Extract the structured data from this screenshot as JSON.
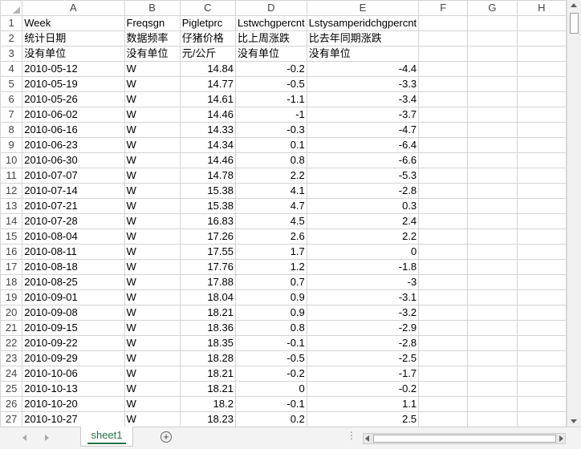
{
  "columns": [
    "",
    "A",
    "B",
    "C",
    "D",
    "E",
    "F",
    "G",
    "H"
  ],
  "rows": [
    {
      "n": "1",
      "cells": [
        "Week",
        "Freqsgn",
        "Pigletprc",
        "Lstwchgpercnt",
        "Lstysamperidchgpercnt",
        "",
        "",
        ""
      ]
    },
    {
      "n": "2",
      "cells": [
        "统计日期",
        "数据频率",
        "仔猪价格",
        "比上周涨跌",
        "比去年同期涨跌",
        "",
        "",
        ""
      ]
    },
    {
      "n": "3",
      "cells": [
        "没有单位",
        "没有单位",
        "元/公斤",
        "没有单位",
        "没有单位",
        "",
        "",
        ""
      ]
    },
    {
      "n": "4",
      "cells": [
        "2010-05-12",
        "W",
        "14.84",
        "-0.2",
        "-4.4",
        "",
        "",
        ""
      ]
    },
    {
      "n": "5",
      "cells": [
        "2010-05-19",
        "W",
        "14.77",
        "-0.5",
        "-3.3",
        "",
        "",
        ""
      ]
    },
    {
      "n": "6",
      "cells": [
        "2010-05-26",
        "W",
        "14.61",
        "-1.1",
        "-3.4",
        "",
        "",
        ""
      ]
    },
    {
      "n": "7",
      "cells": [
        "2010-06-02",
        "W",
        "14.46",
        "-1",
        "-3.7",
        "",
        "",
        ""
      ]
    },
    {
      "n": "8",
      "cells": [
        "2010-06-16",
        "W",
        "14.33",
        "-0.3",
        "-4.7",
        "",
        "",
        ""
      ]
    },
    {
      "n": "9",
      "cells": [
        "2010-06-23",
        "W",
        "14.34",
        "0.1",
        "-6.4",
        "",
        "",
        ""
      ]
    },
    {
      "n": "10",
      "cells": [
        "2010-06-30",
        "W",
        "14.46",
        "0.8",
        "-6.6",
        "",
        "",
        ""
      ]
    },
    {
      "n": "11",
      "cells": [
        "2010-07-07",
        "W",
        "14.78",
        "2.2",
        "-5.3",
        "",
        "",
        ""
      ]
    },
    {
      "n": "12",
      "cells": [
        "2010-07-14",
        "W",
        "15.38",
        "4.1",
        "-2.8",
        "",
        "",
        ""
      ]
    },
    {
      "n": "13",
      "cells": [
        "2010-07-21",
        "W",
        "15.38",
        "4.7",
        "0.3",
        "",
        "",
        ""
      ]
    },
    {
      "n": "14",
      "cells": [
        "2010-07-28",
        "W",
        "16.83",
        "4.5",
        "2.4",
        "",
        "",
        ""
      ]
    },
    {
      "n": "15",
      "cells": [
        "2010-08-04",
        "W",
        "17.26",
        "2.6",
        "2.2",
        "",
        "",
        ""
      ]
    },
    {
      "n": "16",
      "cells": [
        "2010-08-11",
        "W",
        "17.55",
        "1.7",
        "0",
        "",
        "",
        ""
      ]
    },
    {
      "n": "17",
      "cells": [
        "2010-08-18",
        "W",
        "17.76",
        "1.2",
        "-1.8",
        "",
        "",
        ""
      ]
    },
    {
      "n": "18",
      "cells": [
        "2010-08-25",
        "W",
        "17.88",
        "0.7",
        "-3",
        "",
        "",
        ""
      ]
    },
    {
      "n": "19",
      "cells": [
        "2010-09-01",
        "W",
        "18.04",
        "0.9",
        "-3.1",
        "",
        "",
        ""
      ]
    },
    {
      "n": "20",
      "cells": [
        "2010-09-08",
        "W",
        "18.21",
        "0.9",
        "-3.2",
        "",
        "",
        ""
      ]
    },
    {
      "n": "21",
      "cells": [
        "2010-09-15",
        "W",
        "18.36",
        "0.8",
        "-2.9",
        "",
        "",
        ""
      ]
    },
    {
      "n": "22",
      "cells": [
        "2010-09-22",
        "W",
        "18.35",
        "-0.1",
        "-2.8",
        "",
        "",
        ""
      ]
    },
    {
      "n": "23",
      "cells": [
        "2010-09-29",
        "W",
        "18.28",
        "-0.5",
        "-2.5",
        "",
        "",
        ""
      ]
    },
    {
      "n": "24",
      "cells": [
        "2010-10-06",
        "W",
        "18.21",
        "-0.2",
        "-1.7",
        "",
        "",
        ""
      ]
    },
    {
      "n": "25",
      "cells": [
        "2010-10-13",
        "W",
        "18.21",
        "0",
        "-0.2",
        "",
        "",
        ""
      ]
    },
    {
      "n": "26",
      "cells": [
        "2010-10-20",
        "W",
        "18.2",
        "-0.1",
        "1.1",
        "",
        "",
        ""
      ]
    },
    {
      "n": "27",
      "cells": [
        "2010-10-27",
        "W",
        "18.23",
        "0.2",
        "2.5",
        "",
        "",
        ""
      ]
    }
  ],
  "tabs": {
    "sheet1": "sheet1",
    "add_sheet_icon": "+",
    "split_icon": "⋮"
  },
  "colors": {
    "tab_accent": "#217346",
    "gridline": "#d4d4d4"
  }
}
